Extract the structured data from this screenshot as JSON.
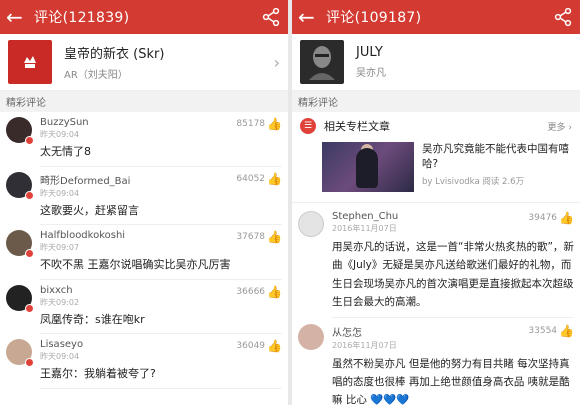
{
  "left": {
    "title": "评论(121839)",
    "song": {
      "name": "皇帝的新衣 (Skr)",
      "artist": "AR（刘夫阳）"
    },
    "section": "精彩评论",
    "comments": [
      {
        "user": "BuzzySun",
        "time": "昨天09:04",
        "likes": "85178",
        "text": "太无情了8"
      },
      {
        "user": "畸形Deformed_Bai",
        "time": "昨天09:04",
        "likes": "64052",
        "text": "这歌要火，赶紧留言"
      },
      {
        "user": "Halfbloodkokoshi",
        "time": "昨天09:07",
        "likes": "37678",
        "text": "不吹不黑 王嘉尔说唱确实比吴亦凡厉害"
      },
      {
        "user": "bixxch",
        "time": "昨天09:02",
        "likes": "36666",
        "text": "凤凰传奇：s谁在咆kr"
      },
      {
        "user": "Lisaseyo",
        "time": "昨天09:04",
        "likes": "36049",
        "text": "王嘉尔：我躺着被夸了?"
      }
    ]
  },
  "right": {
    "title": "评论(109187)",
    "song": {
      "name": "JULY",
      "artist": "吴亦凡"
    },
    "section": "精彩评论",
    "related": {
      "label": "相关专栏文章",
      "more": "更多",
      "article_title": "吴亦凡究竟能不能代表中国有嘻哈?",
      "article_meta": "by Lvisivodka 阅读 2.6万"
    },
    "comments": [
      {
        "user": "Stephen_Chu",
        "time": "2016年11月07日",
        "likes": "39476",
        "text": "用吴亦凡的话说，这是一首“非常火热炙热的歌”，新曲《July》无疑是吴亦凡送给歌迷们最好的礼物，而生日会现场吴亦凡的首次演唱更是直接掀起本次超级生日会最大的高潮。"
      },
      {
        "user": "从怎怎",
        "time": "2016年11月07日",
        "likes": "33554",
        "text": "虽然不粉吴亦凡 但是他的努力有目共睹 每次坚持真唱的态度也很棒 再加上绝世颜值身高衣品 咦就是酷嘛 比心 💙💙💙"
      }
    ]
  },
  "colors": {
    "accent": "#d33a31"
  }
}
